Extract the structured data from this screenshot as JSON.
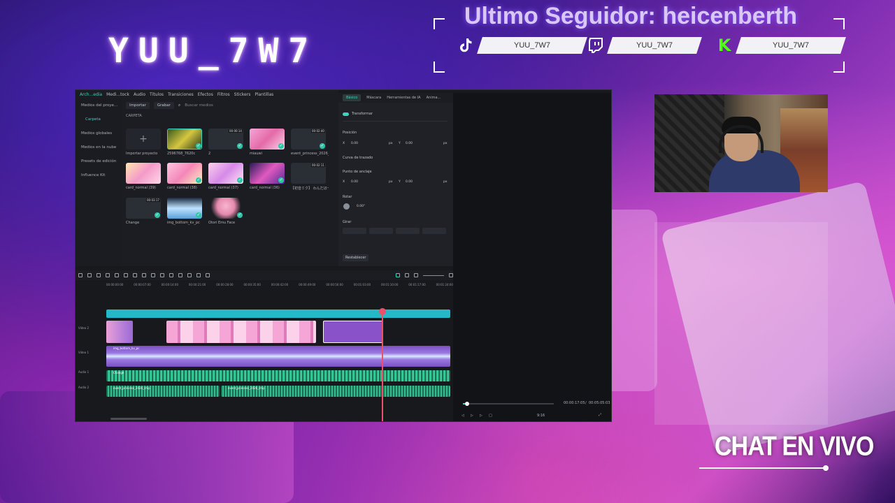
{
  "overlay": {
    "channel_name": "YUU_7W7",
    "last_follower": "Ultimo Seguidor: heicenberth",
    "socials": [
      {
        "platform_icon": "tiktok-icon",
        "handle": "YUU_7W7"
      },
      {
        "platform_icon": "twitch-icon",
        "handle": "YUU_7W7"
      },
      {
        "platform_icon": "kick-icon",
        "icon_text": "K",
        "handle": "YUU_7W7"
      }
    ],
    "chat_label": "CHAT EN VIVO"
  },
  "editor": {
    "menu": [
      "Arch...edia",
      "Medi...tock",
      "Audio",
      "Títulos",
      "Transiciones",
      "Efectos",
      "Filtros",
      "Stickers",
      "Plantillas"
    ],
    "sidebar": [
      "Medios del proye...",
      "Carpeta",
      "Medios globales",
      "Medios en la nube",
      "Presets de edición",
      "Influence Kit"
    ],
    "media_toolbar": {
      "import": "Importar",
      "record": "Grabar",
      "search_placeholder": "Buscar medios"
    },
    "folder_label": "CARPETA",
    "media_items": [
      {
        "label": "Importar proyecto",
        "duration": ""
      },
      {
        "label": "2596768_7620c",
        "duration": ""
      },
      {
        "label": "2",
        "duration": "00:00:14"
      },
      {
        "label": "miauwi",
        "duration": ""
      },
      {
        "label": "event_princess_2026_i...",
        "duration": "00:02:40"
      },
      {
        "label": "card_normal (39)",
        "duration": ""
      },
      {
        "label": "card_normal (38)",
        "duration": ""
      },
      {
        "label": "card_normal (37)",
        "duration": ""
      },
      {
        "label": "card_normal (36)",
        "duration": ""
      },
      {
        "label": "【初音ミク】 わんだほーい...",
        "duration": "00:02:11"
      },
      {
        "label": "Change",
        "duration": "00:03:17"
      },
      {
        "label": "img_bottom_kv_pc",
        "duration": ""
      },
      {
        "label": "Otori Emu Face",
        "duration": ""
      }
    ],
    "properties": {
      "tabs": [
        "Básico",
        "Máscara",
        "Herramientas de IA",
        "Anima..."
      ],
      "transform": "Transformar",
      "position": "Posición",
      "x_label": "X",
      "x_value": "0.00",
      "y_label": "Y",
      "y_value": "0.00",
      "unit": "px",
      "path_curve": "Curva de trazado",
      "anchor": "Punto de anclaje",
      "anchor_x": "0.00",
      "anchor_y": "0.00",
      "rotate": "Rotar",
      "rotate_value": "0.00°",
      "flip": "Girar",
      "reset": "Restablecer"
    },
    "timeline": {
      "ruler": [
        "00:00:00:00",
        "00:00:07:00",
        "00:00:14:00",
        "00:00:21:00",
        "00:00:28:00",
        "00:00:35:00",
        "00:00:42:00",
        "00:00:49:00",
        "00:00:56:00",
        "00:01:03:00",
        "00:01:10:00",
        "00:01:17:00",
        "00:01:24:00"
      ],
      "tracks": [
        "Video 2",
        "Video 1",
        "Audio 1",
        "Audio 2"
      ],
      "clip_labels": {
        "bg": "img_bottom_kv_pc",
        "audio1": "Change",
        "audio2a": "event_princess_2026_chip",
        "audio2b": "event_princess_2026_chip"
      }
    },
    "player": {
      "current_time": "00:00:17:05",
      "total_time": "00:05:05:03",
      "ratio": "9:16",
      "progress_percent": 2
    }
  },
  "colors": {
    "accent": "#3ed1c0",
    "playhead": "#f04f6a",
    "audio": "#2fbf8f",
    "video_clip": "#8a52c9",
    "title_track": "#26b8c8"
  }
}
